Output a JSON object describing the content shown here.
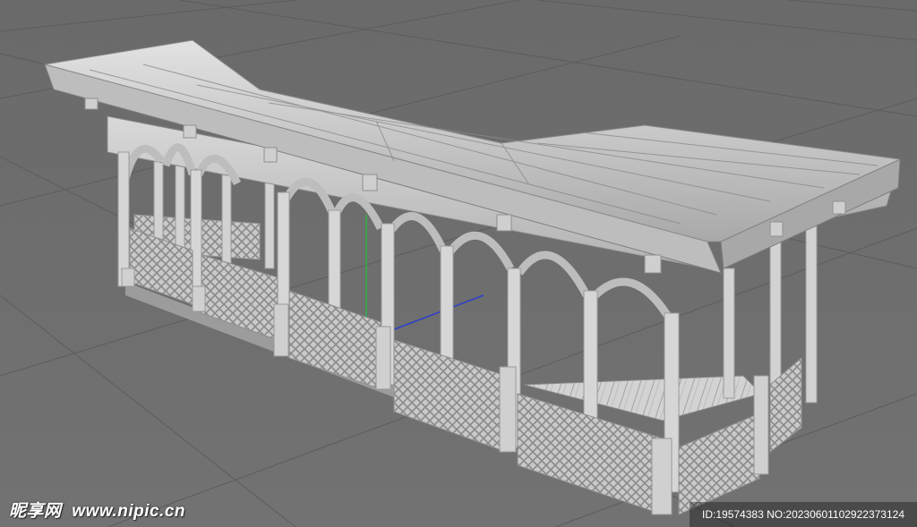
{
  "viewport": {
    "background_color": "#6e6e6e",
    "grid_color": "#5a5a5a",
    "model_color": "#c8c8c8",
    "axis_y_color": "#2bb24a",
    "axis_z_color": "#2f3fc8",
    "model_icon": "pavilion-corridor-model"
  },
  "watermark": {
    "site_name_cn": "昵享网",
    "site_url": "www.nipic.cn",
    "image_info": "ID:19574383 NO:20230601102922373124"
  }
}
